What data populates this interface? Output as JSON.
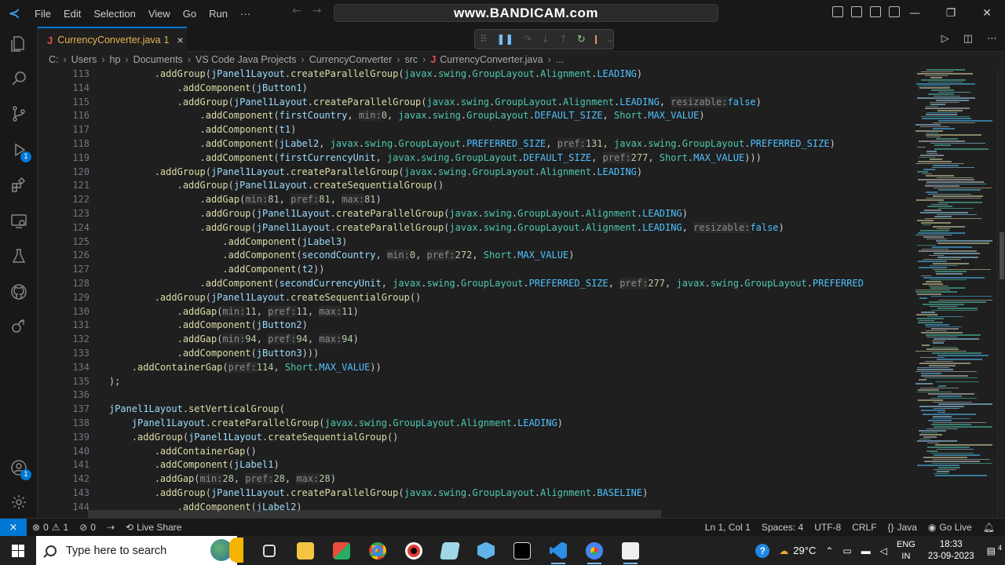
{
  "menu": [
    "File",
    "Edit",
    "Selection",
    "View",
    "Go",
    "Run",
    "···"
  ],
  "command_center": "www.BANDICAM.com",
  "tab": {
    "icon": "J",
    "name": "CurrencyConverter.java",
    "problems": "1",
    "close": "×"
  },
  "breadcrumb": [
    "C:",
    "Users",
    "hp",
    "Documents",
    "VS Code Java Projects",
    "CurrencyConverter",
    "src",
    "CurrencyConverter.java",
    "..."
  ],
  "breadcrumb_file_icon": "J",
  "activity_badges": {
    "run_debug": "1",
    "accounts": "1"
  },
  "line_numbers": [
    "113",
    "114",
    "115",
    "116",
    "117",
    "118",
    "119",
    "120",
    "121",
    "122",
    "123",
    "124",
    "125",
    "126",
    "127",
    "128",
    "129",
    "130",
    "131",
    "132",
    "133",
    "134",
    "135",
    "136",
    "137",
    "138",
    "139",
    "140",
    "141",
    "142",
    "143",
    "144"
  ],
  "code_lines": [
    "            .addGroup(jPanel1Layout.createParallelGroup(javax.swing.GroupLayout.Alignment.LEADING)",
    "                .addComponent(jButton1)",
    "                .addGroup(jPanel1Layout.createParallelGroup(javax.swing.GroupLayout.Alignment.LEADING, resizable:false)",
    "                    .addComponent(firstCountry, min:0, javax.swing.GroupLayout.DEFAULT_SIZE, Short.MAX_VALUE)",
    "                    .addComponent(t1)",
    "                    .addComponent(jLabel2, javax.swing.GroupLayout.PREFERRED_SIZE, pref:131, javax.swing.GroupLayout.PREFERRED_SIZE)",
    "                    .addComponent(firstCurrencyUnit, javax.swing.GroupLayout.DEFAULT_SIZE, pref:277, Short.MAX_VALUE)))",
    "            .addGroup(jPanel1Layout.createParallelGroup(javax.swing.GroupLayout.Alignment.LEADING)",
    "                .addGroup(jPanel1Layout.createSequentialGroup()",
    "                    .addGap(min:81, pref:81, max:81)",
    "                    .addGroup(jPanel1Layout.createParallelGroup(javax.swing.GroupLayout.Alignment.LEADING)",
    "                    .addGroup(jPanel1Layout.createParallelGroup(javax.swing.GroupLayout.Alignment.LEADING, resizable:false)",
    "                        .addComponent(jLabel3)",
    "                        .addComponent(secondCountry, min:0, pref:272, Short.MAX_VALUE)",
    "                        .addComponent(t2))",
    "                    .addComponent(secondCurrencyUnit, javax.swing.GroupLayout.PREFERRED_SIZE, pref:277, javax.swing.GroupLayout.PREFERRED",
    "            .addGroup(jPanel1Layout.createSequentialGroup()",
    "                .addGap(min:11, pref:11, max:11)",
    "                .addComponent(jButton2)",
    "                .addGap(min:94, pref:94, max:94)",
    "                .addComponent(jButton3)))",
    "        .addContainerGap(pref:114, Short.MAX_VALUE))",
    "    );",
    "",
    "    jPanel1Layout.setVerticalGroup(",
    "        jPanel1Layout.createParallelGroup(javax.swing.GroupLayout.Alignment.LEADING)",
    "        .addGroup(jPanel1Layout.createSequentialGroup()",
    "            .addContainerGap()",
    "            .addComponent(jLabel1)",
    "            .addGap(min:28, pref:28, max:28)",
    "            .addGroup(jPanel1Layout.createParallelGroup(javax.swing.GroupLayout.Alignment.BASELINE)",
    "                .addComponent(jLabel2)"
  ],
  "status": {
    "remote": "⨯",
    "errors": "0",
    "warnings": "1",
    "ports": "0",
    "live_share": "Live Share",
    "position": "Ln 1, Col 1",
    "spaces": "Spaces: 4",
    "encoding": "UTF-8",
    "eol": "CRLF",
    "language": "Java",
    "go_live": "Go Live"
  },
  "taskbar": {
    "search_placeholder": "Type here to search",
    "weather": "29°C",
    "lang_top": "ENG",
    "lang_bottom": "IN",
    "time": "18:33",
    "date": "23-09-2023",
    "notifications": "4"
  },
  "colors": {
    "accent": "#0078d4",
    "warning": "#e2b54f",
    "java": "#f14c4c"
  }
}
